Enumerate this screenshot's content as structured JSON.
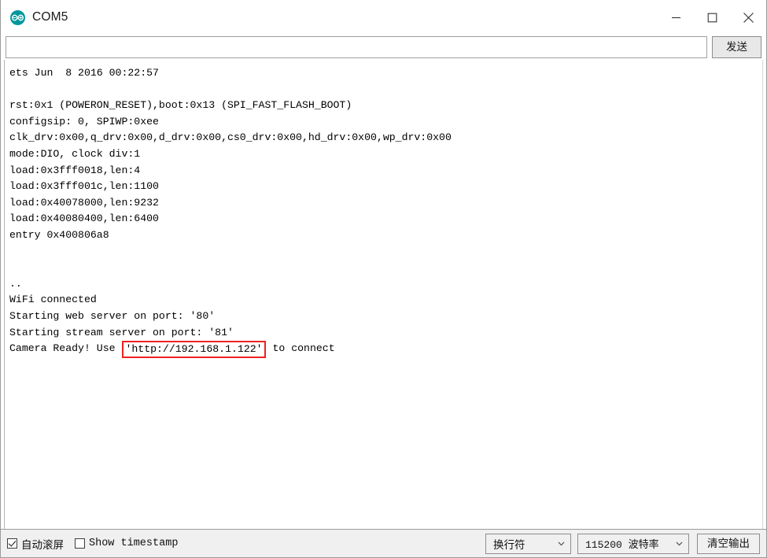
{
  "window": {
    "title": "COM5",
    "logo_icon": "arduino-infinity-icon",
    "controls": [
      {
        "name": "minimize",
        "icon": "minimize-icon"
      },
      {
        "name": "maximize",
        "icon": "maximize-icon"
      },
      {
        "name": "close",
        "icon": "close-icon"
      }
    ]
  },
  "send_row": {
    "input_value": "",
    "input_placeholder": "",
    "send_label": "发送"
  },
  "console": {
    "lines": [
      {
        "text": "ets Jun  8 2016 00:22:57"
      },
      {
        "text": ""
      },
      {
        "text": "rst:0x1 (POWERON_RESET),boot:0x13 (SPI_FAST_FLASH_BOOT)"
      },
      {
        "text": "configsip: 0, SPIWP:0xee"
      },
      {
        "text": "clk_drv:0x00,q_drv:0x00,d_drv:0x00,cs0_drv:0x00,hd_drv:0x00,wp_drv:0x00"
      },
      {
        "text": "mode:DIO, clock div:1"
      },
      {
        "text": "load:0x3fff0018,len:4"
      },
      {
        "text": "load:0x3fff001c,len:1100"
      },
      {
        "text": "load:0x40078000,len:9232"
      },
      {
        "text": "load:0x40080400,len:6400"
      },
      {
        "text": "entry 0x400806a8"
      },
      {
        "text": ""
      },
      {
        "text": ""
      },
      {
        "text": ".."
      },
      {
        "text": "WiFi connected"
      },
      {
        "text": "Starting web server on port: '80'"
      },
      {
        "text": "Starting stream server on port: '81'"
      },
      {
        "pre": "Camera Ready! Use ",
        "highlight": "'http://192.168.1.122'",
        "post": " to connect"
      }
    ],
    "highlight_color": "#ee2222"
  },
  "bottom_bar": {
    "autoscroll_label": "自动滚屏",
    "autoscroll_checked": true,
    "timestamp_label": "Show timestamp",
    "timestamp_checked": false,
    "newline_select": "换行符",
    "baud_select": "115200 波特率",
    "clear_label": "清空输出"
  }
}
